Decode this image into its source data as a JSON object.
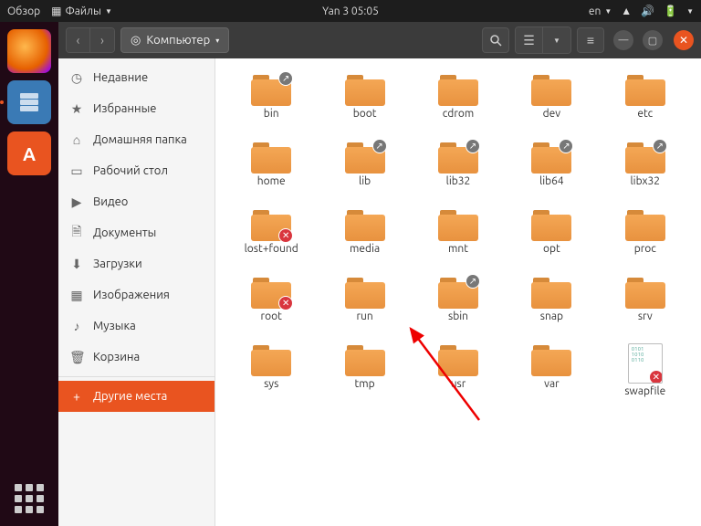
{
  "topbar": {
    "overview": "Обзор",
    "files_menu": "Файлы",
    "clock": "Yan 3  05:05",
    "lang": "en"
  },
  "window": {
    "location": "Компьютер"
  },
  "sidebar": {
    "items": [
      {
        "icon": "◷",
        "label": "Недавние"
      },
      {
        "icon": "★",
        "label": "Избранные"
      },
      {
        "icon": "⌂",
        "label": "Домашняя папка"
      },
      {
        "icon": "▭",
        "label": "Рабочий стол"
      },
      {
        "icon": "▶",
        "label": "Видео"
      },
      {
        "icon": "🗎",
        "label": "Документы"
      },
      {
        "icon": "⬇",
        "label": "Загрузки"
      },
      {
        "icon": "▦",
        "label": "Изображения"
      },
      {
        "icon": "♪",
        "label": "Музыка"
      },
      {
        "icon": "🗑",
        "label": "Корзина"
      }
    ],
    "other": {
      "icon": "+",
      "label": "Другие места"
    }
  },
  "files": [
    {
      "name": "bin",
      "type": "folder",
      "badge": "link"
    },
    {
      "name": "boot",
      "type": "folder"
    },
    {
      "name": "cdrom",
      "type": "folder"
    },
    {
      "name": "dev",
      "type": "folder"
    },
    {
      "name": "etc",
      "type": "folder"
    },
    {
      "name": "home",
      "type": "folder"
    },
    {
      "name": "lib",
      "type": "folder",
      "badge": "link"
    },
    {
      "name": "lib32",
      "type": "folder",
      "badge": "link"
    },
    {
      "name": "lib64",
      "type": "folder",
      "badge": "link"
    },
    {
      "name": "libx32",
      "type": "folder",
      "badge": "link"
    },
    {
      "name": "lost+found",
      "type": "folder",
      "badge": "deny"
    },
    {
      "name": "media",
      "type": "folder"
    },
    {
      "name": "mnt",
      "type": "folder"
    },
    {
      "name": "opt",
      "type": "folder"
    },
    {
      "name": "proc",
      "type": "folder"
    },
    {
      "name": "root",
      "type": "folder",
      "badge": "deny"
    },
    {
      "name": "run",
      "type": "folder"
    },
    {
      "name": "sbin",
      "type": "folder",
      "badge": "link"
    },
    {
      "name": "snap",
      "type": "folder"
    },
    {
      "name": "srv",
      "type": "folder"
    },
    {
      "name": "sys",
      "type": "folder"
    },
    {
      "name": "tmp",
      "type": "folder"
    },
    {
      "name": "usr",
      "type": "folder"
    },
    {
      "name": "var",
      "type": "folder"
    },
    {
      "name": "swapfile",
      "type": "file",
      "badge": "deny"
    }
  ]
}
